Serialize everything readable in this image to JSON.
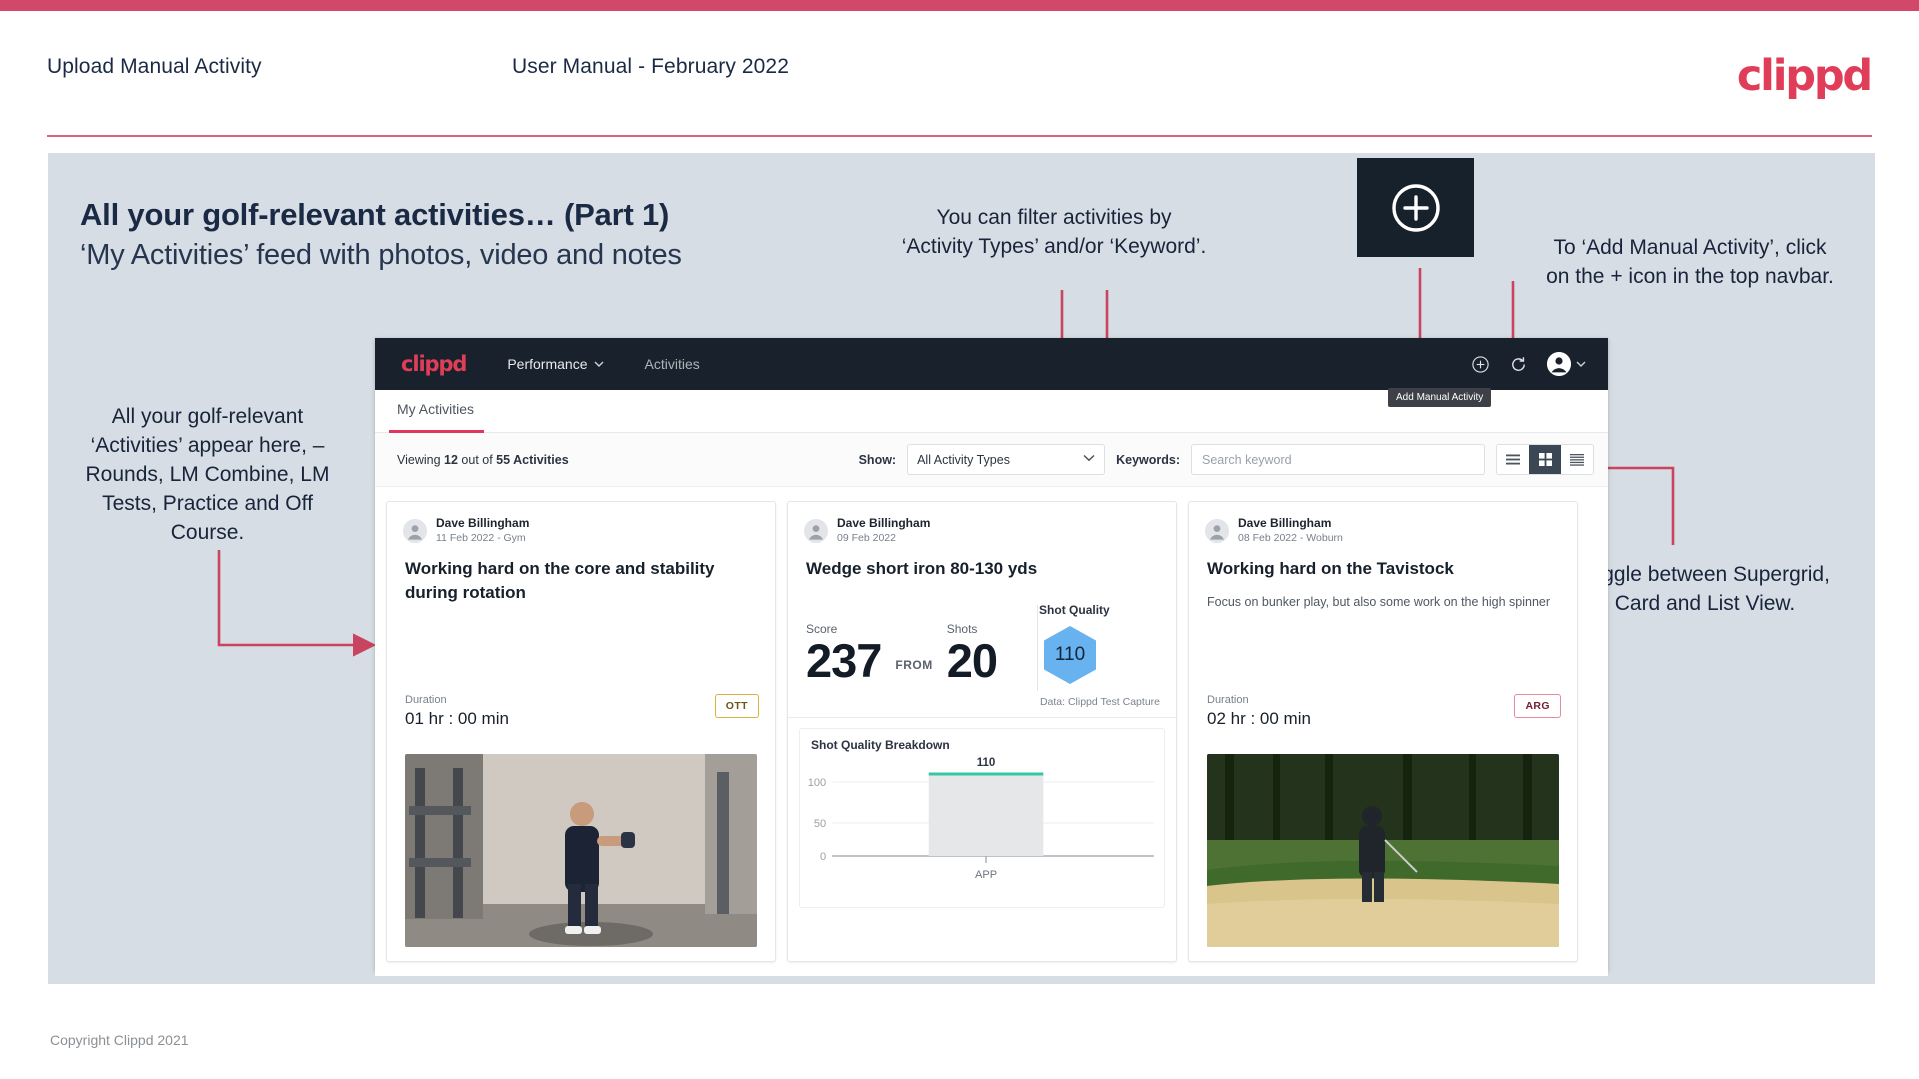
{
  "slide": {
    "header_title": "Upload Manual Activity",
    "header_subtitle": "User Manual - February 2022",
    "logo": "clippd",
    "title_main": "All your golf-relevant activities… (Part 1)",
    "title_sub": "‘My Activities’ feed with photos, video and notes",
    "footer": "Copyright Clippd 2021"
  },
  "callouts": {
    "filter": "You can filter activities by ‘Activity Types’ and/or ‘Keyword’.",
    "add_manual": "To ‘Add Manual Activity’, click on the + icon in the top navbar.",
    "activities_feed": "All your golf-relevant ‘Activities’ appear here, – Rounds, LM Combine, LM Tests, Practice and Off Course.",
    "toggle_views": "Toggle between Supergrid, Card and List View."
  },
  "app": {
    "navbar": {
      "logo": "clippd",
      "links": [
        {
          "label": "Performance",
          "icon": "chevron-down-icon"
        },
        {
          "label": "Activities",
          "icon": ""
        }
      ],
      "add_icon": "plus-circle-icon",
      "refresh_icon": "refresh-icon",
      "avatar_icon": "account-circle-icon",
      "avatar_chevron": "chevron-down-icon",
      "tooltip": "Add Manual Activity"
    },
    "tabs": [
      {
        "label": "My Activities",
        "active": true
      }
    ],
    "filterbar": {
      "viewing_prefix": "Viewing ",
      "viewing_count": "12",
      "viewing_middle": " out of ",
      "viewing_total": "55 Activities",
      "show_label": "Show:",
      "activity_type_value": "All Activity Types",
      "keywords_label": "Keywords:",
      "keyword_placeholder": "Search keyword",
      "view_toggles": [
        {
          "name": "supergrid-view",
          "active": false
        },
        {
          "name": "card-view",
          "active": true
        },
        {
          "name": "list-view",
          "active": false
        }
      ]
    },
    "cards": [
      {
        "user": "Dave Billingham",
        "meta": "11 Feb 2022 - Gym",
        "title": "Working hard on the core and stability during rotation",
        "note": "",
        "duration_label": "Duration",
        "duration_value": "01 hr : 00 min",
        "tag": "OTT",
        "media": "gym-photo"
      },
      {
        "user": "Dave Billingham",
        "meta": "09 Feb 2022",
        "title": "Wedge short iron 80-130 yds",
        "score_label": "Score",
        "score_value": "237",
        "from_label": "FROM",
        "shots_label": "Shots",
        "shots_value": "20",
        "shot_quality_label": "Shot Quality",
        "shot_quality_value": "110",
        "data_source": "Data: Clippd Test Capture",
        "chart_title": "Shot Quality Breakdown"
      },
      {
        "user": "Dave Billingham",
        "meta": "08 Feb 2022 - Woburn",
        "title": "Working hard on the Tavistock",
        "note": "Focus on bunker play, but also some work on the high spinner",
        "duration_label": "Duration",
        "duration_value": "02 hr : 00 min",
        "tag": "ARG",
        "media": "bunker-photo"
      }
    ]
  },
  "chart_data": {
    "type": "bar",
    "title": "Shot Quality Breakdown",
    "categories": [
      "APP"
    ],
    "values": [
      110
    ],
    "data_labels": [
      "110"
    ],
    "xlabel": "",
    "ylabel": "",
    "ylim": [
      0,
      125
    ],
    "yticks": [
      0,
      50,
      100
    ],
    "ytick_labels": [
      "0",
      "50",
      "100"
    ],
    "grid": true,
    "legend": "none",
    "bar_fill": "#e6e7e8",
    "bar_cap_color": "#35c6a5"
  },
  "colors": {
    "brand_red": "#e03e58",
    "accent_line": "#d2486a",
    "slide_bg": "#d7dde5",
    "navbar_bg": "#19222c",
    "hex_blue": "#69b2f0"
  }
}
